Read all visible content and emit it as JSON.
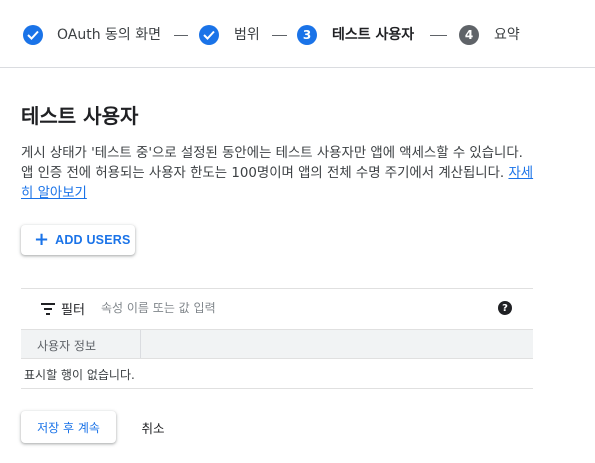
{
  "stepper": {
    "steps": [
      {
        "label": "OAuth 동의 화면",
        "state": "completed",
        "icon": "check-icon"
      },
      {
        "label": "범위",
        "state": "completed",
        "icon": "check-icon"
      },
      {
        "label": "테스트 사용자",
        "state": "active",
        "number": "3"
      },
      {
        "label": "요약",
        "state": "upcoming",
        "number": "4"
      }
    ]
  },
  "page": {
    "heading": "테스트 사용자",
    "description": "게시 상태가 '테스트 중'으로 설정된 동안에는 테스트 사용자만 앱에 액세스할 수 있습니다. 앱 인증 전에 허용되는 사용자 한도는 100명이며 앱의 전체 수명 주기에서 계산됩니다.",
    "learn_more": "자세히 알아보기"
  },
  "add_users": {
    "label": "ADD USERS",
    "icon": "plus-icon"
  },
  "table": {
    "filter_label": "필터",
    "filter_placeholder": "속성 이름 또는 값 입력",
    "columns": [
      "사용자 정보"
    ],
    "empty_message": "표시할 행이 없습니다."
  },
  "footer": {
    "save_label": "저장 후 계속",
    "cancel_label": "취소"
  },
  "colors": {
    "accent": "#1a73e8",
    "step_upcoming": "#5f6368",
    "header_bg": "#f1f3f4"
  }
}
